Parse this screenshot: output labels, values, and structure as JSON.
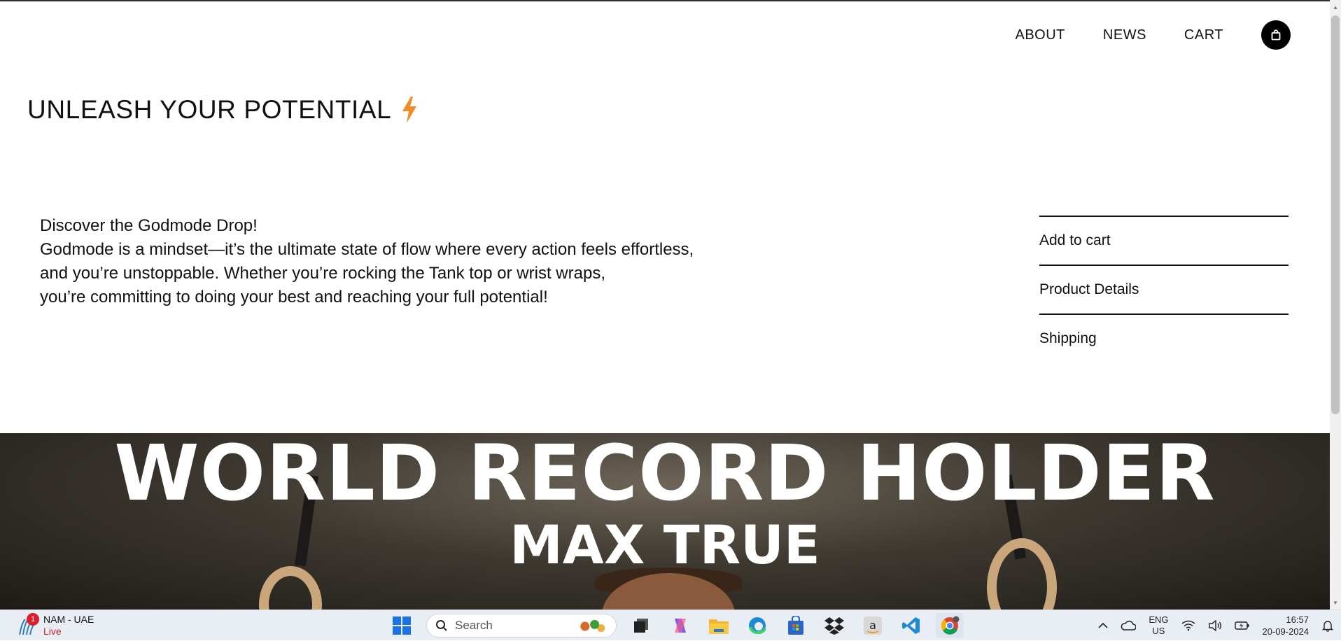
{
  "nav": {
    "items": [
      "ABOUT",
      "NEWS",
      "CART"
    ],
    "bag_icon": "shopping-bag-icon"
  },
  "headline": {
    "text": "UNLEASH YOUR POTENTIAL",
    "icon": "lightning-bolt-icon",
    "icon_color": "#f28c28"
  },
  "description": {
    "lines": [
      "Discover the Godmode Drop!",
      "Godmode is a mindset—it’s the ultimate state of flow where every action feels effortless,",
      "and you’re unstoppable. Whether you’re rocking the Tank top or wrist wraps,",
      "you’re committing to doing your best and reaching your full potential!"
    ]
  },
  "accordion": {
    "items": [
      "Add to cart",
      "Product Details",
      "Shipping"
    ]
  },
  "hero": {
    "title": "WORLD RECORD HOLDER",
    "subtitle": "MAX TRUE"
  },
  "taskbar": {
    "weather": {
      "badge": "1",
      "location": "NAM - UAE",
      "status": "Live"
    },
    "search_placeholder": "Search",
    "apps": [
      "start-icon",
      "task-view-icon",
      "copilot-icon",
      "file-explorer-icon",
      "edge-icon",
      "store-icon",
      "dropbox-icon",
      "amazon-icon",
      "vscode-icon",
      "chrome-icon"
    ],
    "tray": {
      "lang_top": "ENG",
      "lang_bottom": "US",
      "time": "16:57",
      "date": "20-09-2024"
    }
  }
}
